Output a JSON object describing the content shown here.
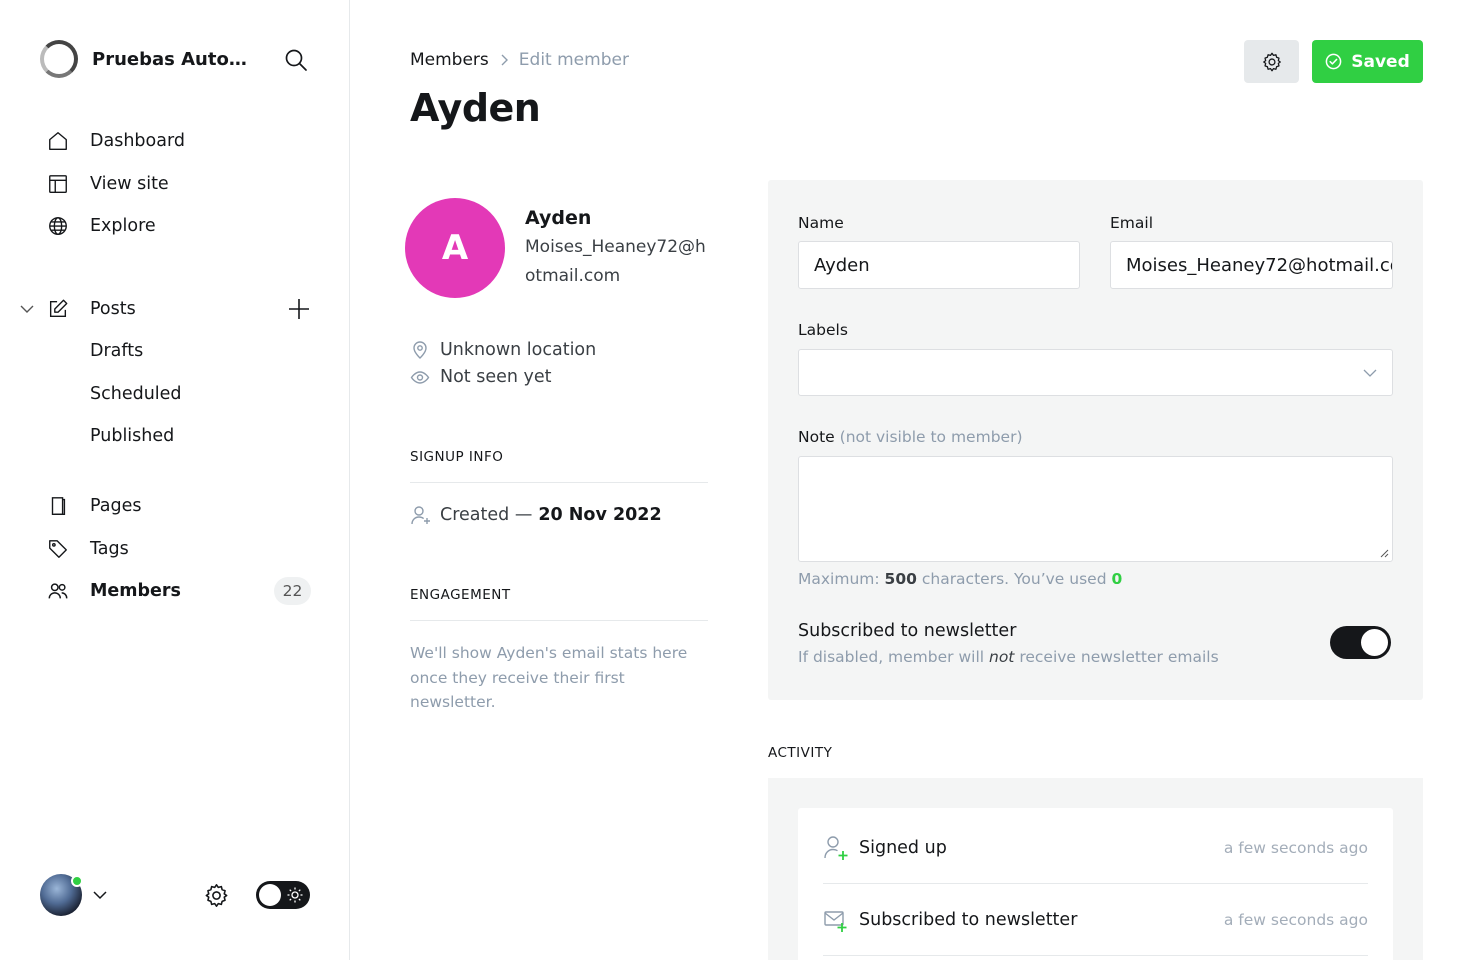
{
  "sidebar": {
    "site_name": "Pruebas Automa...",
    "nav": {
      "dashboard": "Dashboard",
      "view_site": "View site",
      "explore": "Explore",
      "posts": "Posts",
      "drafts": "Drafts",
      "scheduled": "Scheduled",
      "published": "Published",
      "pages": "Pages",
      "tags": "Tags",
      "members": "Members",
      "members_count": "22"
    }
  },
  "header": {
    "breadcrumb_parent": "Members",
    "breadcrumb_current": "Edit member",
    "title": "Ayden",
    "saved_label": "Saved"
  },
  "member": {
    "initial": "A",
    "name": "Ayden",
    "email": "Moises_Heaney72@hotmail.com",
    "location": "Unknown location",
    "last_seen": "Not seen yet",
    "avatar_color": "#e339b7"
  },
  "signup": {
    "heading": "SIGNUP INFO",
    "created_label": "Created —",
    "created_date": "20 Nov 2022"
  },
  "engagement": {
    "heading": "ENGAGEMENT",
    "text": "We'll show Ayden's email stats here once they receive their first newsletter."
  },
  "form": {
    "name_label": "Name",
    "name_value": "Ayden",
    "email_label": "Email",
    "email_value": "Moises_Heaney72@hotmail.com",
    "labels_label": "Labels",
    "note_label": "Note",
    "note_hint": "(not visible to member)",
    "max_prefix": "Maximum:",
    "max_chars": "500",
    "max_mid": "characters. You’ve used",
    "used_chars": "0",
    "subscribed_title": "Subscribed to newsletter",
    "subscribed_desc_pre": "If disabled, member will",
    "subscribed_desc_em": "not",
    "subscribed_desc_post": "receive newsletter emails",
    "subscribed": true
  },
  "activity": {
    "heading": "ACTIVITY",
    "items": [
      {
        "label": "Signed up",
        "time": "a few seconds ago"
      },
      {
        "label": "Subscribed to newsletter",
        "time": "a few seconds ago"
      }
    ]
  },
  "colors": {
    "accent_green": "#30cf43",
    "text_dark": "#15171a",
    "muted": "#8e9cac"
  }
}
